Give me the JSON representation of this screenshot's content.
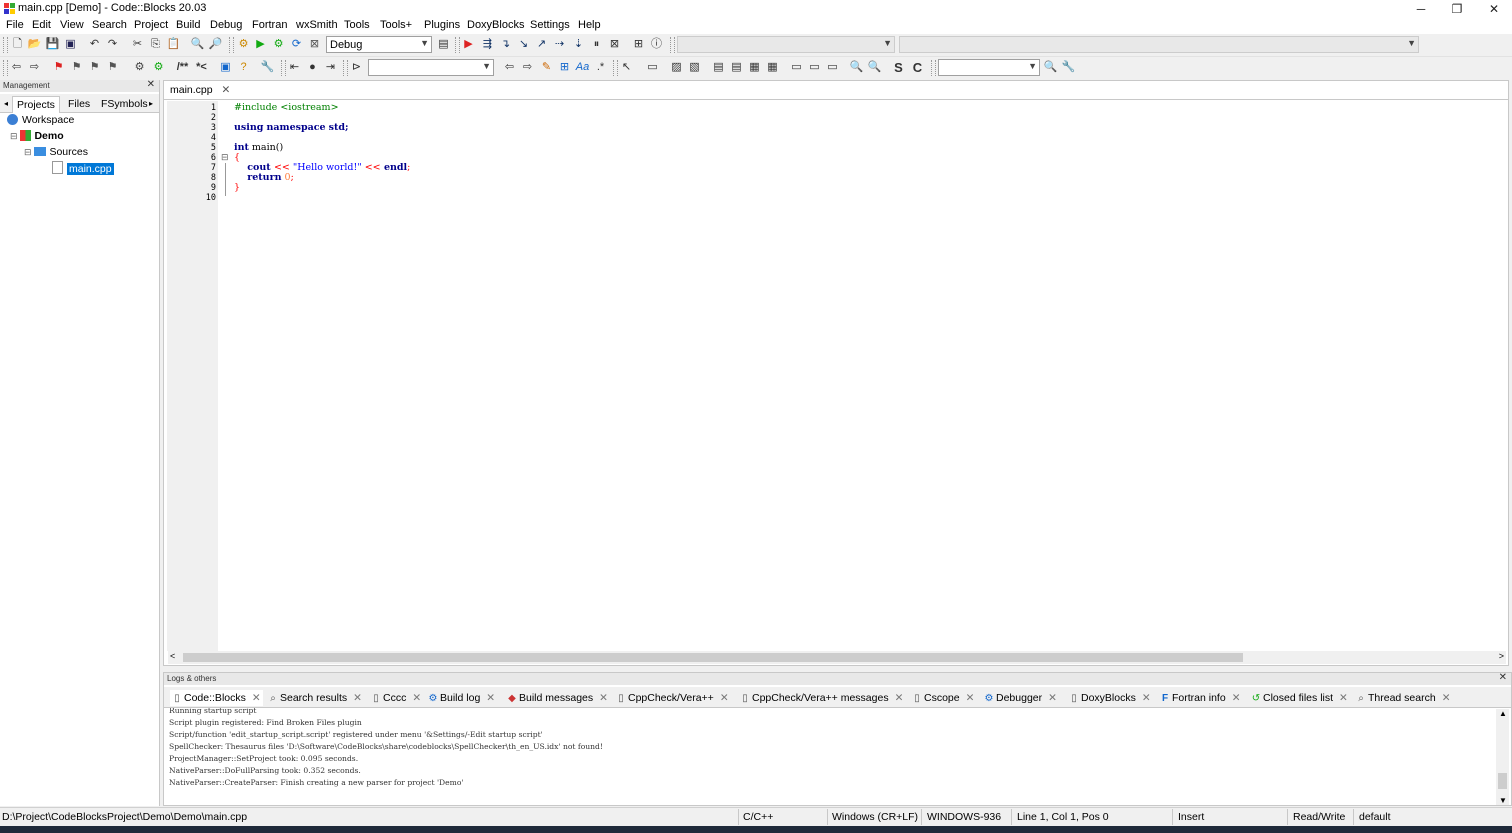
{
  "window": {
    "title": "main.cpp [Demo] - Code::Blocks 20.03",
    "controls": [
      "─",
      "❐",
      "✕"
    ]
  },
  "menu": [
    "File",
    "Edit",
    "View",
    "Search",
    "Project",
    "Build",
    "Debug",
    "Fortran",
    "wxSmith",
    "Tools",
    "Tools+",
    "Plugins",
    "DoxyBlocks",
    "Settings",
    "Help"
  ],
  "toolbar": {
    "build_target": "Debug",
    "search_combo": "",
    "find_combo": ""
  },
  "management": {
    "header": "Management",
    "tabs": [
      "Projects",
      "Files",
      "FSymbols"
    ],
    "tree": {
      "workspace": "Workspace",
      "project": "Demo",
      "folder": "Sources",
      "file": "main.cpp"
    }
  },
  "editor": {
    "tab": "main.cpp",
    "line_numbers": [
      "1",
      "2",
      "3",
      "4",
      "5",
      "6",
      "7",
      "8",
      "9",
      "10"
    ],
    "code": {
      "l1_include": "#include <iostream>",
      "l3_using": "using",
      "l3_namespace": "namespace",
      "l3_std": "std;",
      "l5_int": "int",
      "l5_main": " main()",
      "l6_brace": "{",
      "l7_cout": "    cout ",
      "l7_op1": "<<",
      "l7_str": " \"Hello world!\" ",
      "l7_op2": "<<",
      "l7_endl": " endl",
      "l7_semi": ";",
      "l8_return": "    return",
      "l8_num": " 0",
      "l8_semi": ";",
      "l9_brace": "}"
    }
  },
  "logs": {
    "header": "Logs & others",
    "tabs": [
      {
        "label": "Code::Blocks",
        "icon": "📄"
      },
      {
        "label": "Search results",
        "icon": "🔍"
      },
      {
        "label": "Cccc",
        "icon": "📝"
      },
      {
        "label": "Build log",
        "icon": "⚙"
      },
      {
        "label": "Build messages",
        "icon": "◆"
      },
      {
        "label": "CppCheck/Vera++",
        "icon": "📝"
      },
      {
        "label": "CppCheck/Vera++ messages",
        "icon": "📝"
      },
      {
        "label": "Cscope",
        "icon": "📝"
      },
      {
        "label": "Debugger",
        "icon": "⚙"
      },
      {
        "label": "DoxyBlocks",
        "icon": "📄"
      },
      {
        "label": "Fortran info",
        "icon": "F"
      },
      {
        "label": "Closed files list",
        "icon": "↺"
      },
      {
        "label": "Thread search",
        "icon": "🔍"
      }
    ],
    "lines": [
      "Running startup script",
      "Script plugin registered: Find Broken Files plugin",
      "Script/function 'edit_startup_script.script' registered under menu '&Settings/-Edit startup script'",
      "SpellChecker: Thesaurus files 'D:\\Software\\CodeBlocks\\share\\codeblocks\\SpellChecker\\th_en_US.idx' not found!",
      "ProjectManager::SetProject took: 0.095 seconds.",
      "NativeParser::DoFullParsing took: 0.352 seconds.",
      "NativeParser::CreateParser: Finish creating a new parser for project 'Demo'"
    ]
  },
  "status": {
    "path": "D:\\Project\\CodeBlocksProject\\Demo\\Demo\\main.cpp",
    "language": "C/C++",
    "eol": "Windows (CR+LF)",
    "encoding": "WINDOWS-936",
    "position": "Line 1, Col 1, Pos 0",
    "mode": "Insert",
    "access": "Read/Write",
    "profile": "default"
  },
  "colors": {
    "keyword": "#00008b",
    "preprocessor": "#008000",
    "string": "#0000ff",
    "number": "#ff8040",
    "operator": "#ff0000",
    "selection": "#0078d7"
  }
}
